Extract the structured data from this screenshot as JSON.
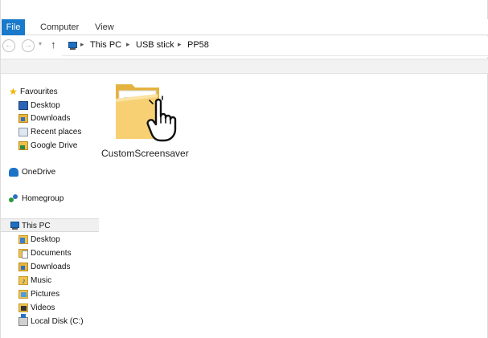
{
  "ribbon": {
    "tabs": [
      "File",
      "Computer",
      "View"
    ],
    "accent_color": "#1979ca"
  },
  "address_bar": {
    "back_icon": "back-arrow-icon",
    "forward_icon": "forward-arrow-icon",
    "up_icon": "up-arrow-icon",
    "breadcrumb": [
      "This PC",
      "USB stick",
      "PP58"
    ],
    "separator": "▸"
  },
  "navigation_pane": {
    "favourites": {
      "label": "Favourites",
      "items": [
        "Desktop",
        "Downloads",
        "Recent places",
        "Google Drive"
      ]
    },
    "onedrive": "OneDrive",
    "homegroup": "Homegroup",
    "this_pc": {
      "label": "This PC",
      "items": [
        "Desktop",
        "Documents",
        "Downloads",
        "Music",
        "Pictures",
        "Videos",
        "Local Disk (C:)"
      ]
    }
  },
  "content": {
    "items": [
      {
        "name": "CustomScreensaver",
        "icon": "folder-icon",
        "cursor": "hand-pointer-icon"
      }
    ]
  }
}
